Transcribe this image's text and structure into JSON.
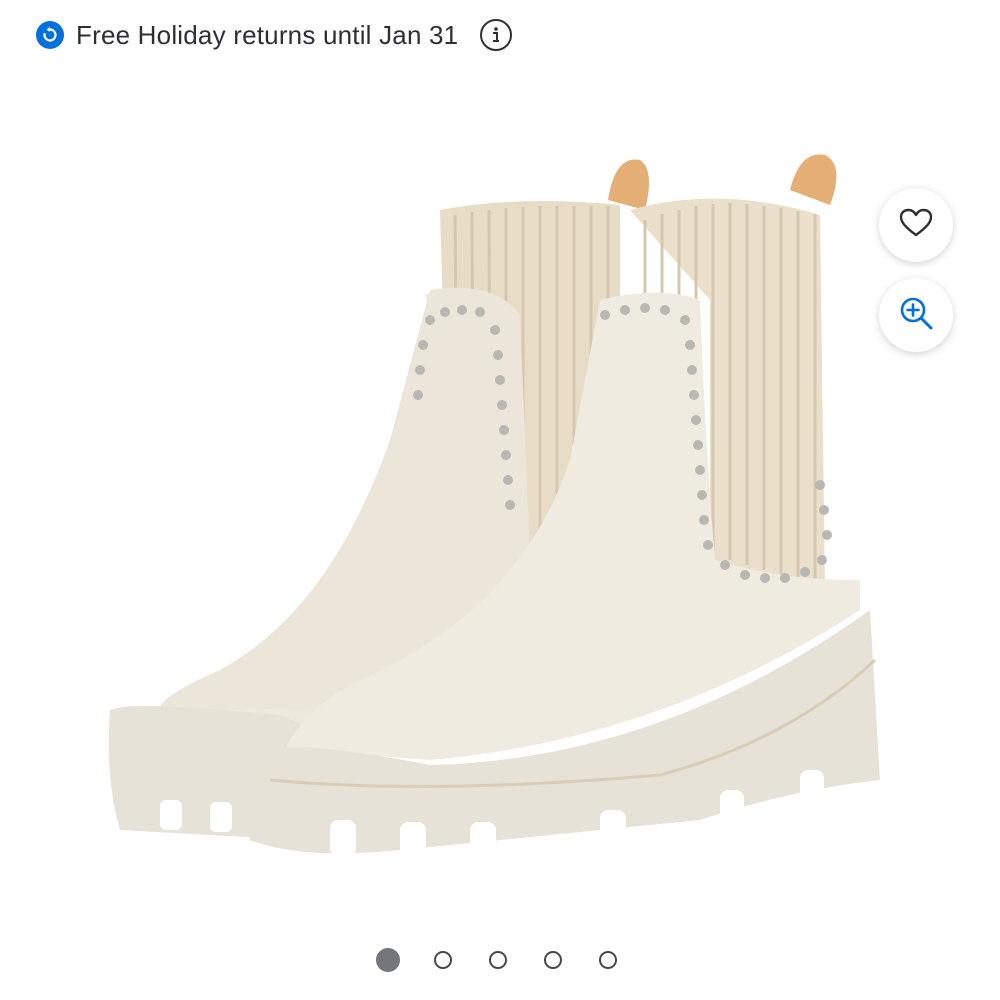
{
  "banner": {
    "text": "Free Holiday returns until Jan 31",
    "icon": "return-arrow-icon",
    "info_icon": "info-icon",
    "accent_color": "#0071dc"
  },
  "product": {
    "image_icon": "boot-pair-image"
  },
  "actions": {
    "favorite_icon": "heart-icon",
    "zoom_icon": "zoom-in-icon",
    "zoom_color": "#0071dc"
  },
  "carousel": {
    "total": 5,
    "active_index": 0
  }
}
